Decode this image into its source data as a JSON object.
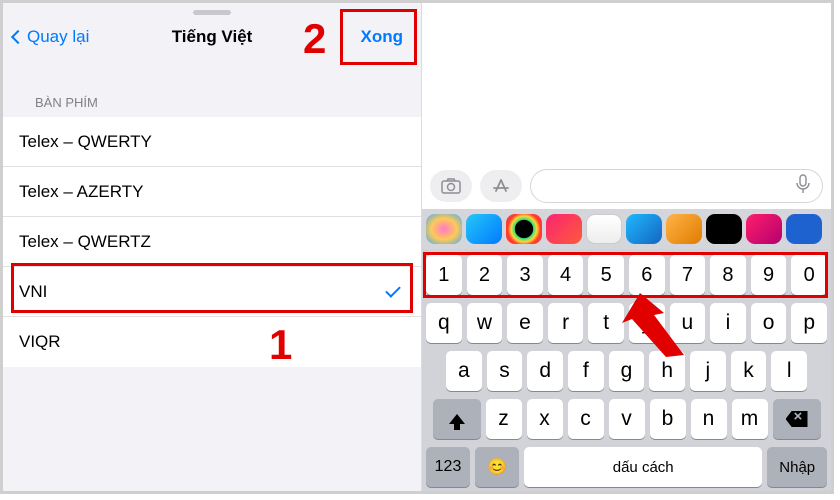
{
  "left": {
    "back_label": "Quay lại",
    "title": "Tiếng Việt",
    "done_label": "Xong",
    "section": "BÀN PHÍM",
    "items": [
      {
        "label": "Telex – QWERTY",
        "selected": false
      },
      {
        "label": "Telex – AZERTY",
        "selected": false
      },
      {
        "label": "Telex – QWERTZ",
        "selected": false
      },
      {
        "label": "VNI",
        "selected": true
      },
      {
        "label": "VIQR",
        "selected": false
      }
    ]
  },
  "annotations": {
    "step1": "1",
    "step2": "2"
  },
  "right": {
    "keyboard": {
      "row_numbers": [
        "1",
        "2",
        "3",
        "4",
        "5",
        "6",
        "7",
        "8",
        "9",
        "0"
      ],
      "row_q": [
        "q",
        "w",
        "e",
        "r",
        "t",
        "y",
        "u",
        "i",
        "o",
        "p"
      ],
      "row_a": [
        "a",
        "s",
        "d",
        "f",
        "g",
        "h",
        "j",
        "k",
        "l"
      ],
      "row_z": [
        "z",
        "x",
        "c",
        "v",
        "b",
        "n",
        "m"
      ],
      "sym_label": "123",
      "emoji_label": "😊",
      "space_label": "dấu cách",
      "enter_label": "Nhập"
    },
    "input_placeholder": ""
  }
}
